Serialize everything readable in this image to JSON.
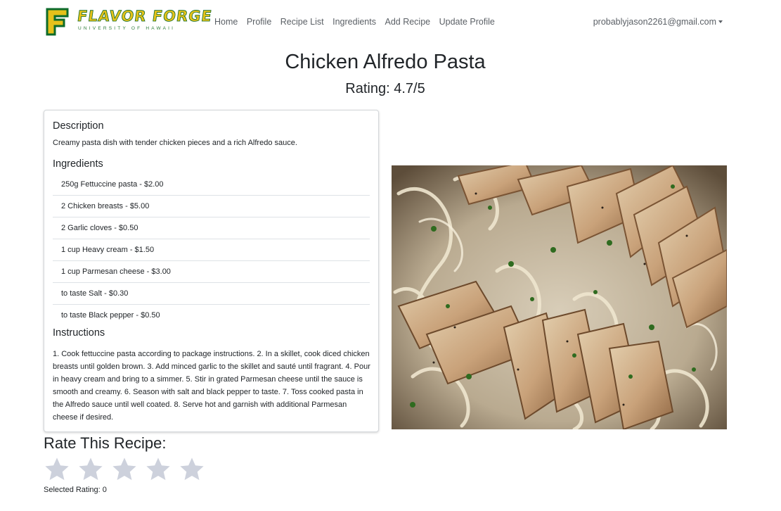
{
  "brand": {
    "name": "FLAVOR FORGE",
    "subtitle": "UNIVERSITY OF HAWAII"
  },
  "nav": {
    "links": [
      "Home",
      "Profile",
      "Recipe List",
      "Ingredients",
      "Add Recipe",
      "Update Profile"
    ],
    "user_email": "probablyjason2261@gmail.com"
  },
  "recipe": {
    "title": "Chicken Alfredo Pasta",
    "rating_text": "Rating: 4.7/5",
    "description_heading": "Description",
    "description": "Creamy pasta dish with tender chicken pieces and a rich Alfredo sauce.",
    "ingredients_heading": "Ingredients",
    "ingredients": [
      "250g Fettuccine pasta - $2.00",
      "2 Chicken breasts - $5.00",
      "2 Garlic cloves - $0.50",
      "1 cup Heavy cream - $1.50",
      "1 cup Parmesan cheese - $3.00",
      "to taste Salt - $0.30",
      "to taste Black pepper - $0.50"
    ],
    "instructions_heading": "Instructions",
    "instructions": "1. Cook fettuccine pasta according to package instructions. 2. In a skillet, cook diced chicken breasts until golden brown. 3. Add minced garlic to the skillet and sauté until fragrant. 4. Pour in heavy cream and bring to a simmer. 5. Stir in grated Parmesan cheese until the sauce is smooth and creamy. 6. Season with salt and black pepper to taste. 7. Toss cooked pasta in the Alfredo sauce until well coated. 8. Serve hot and garnish with additional Parmesan cheese if desired."
  },
  "rate": {
    "heading": "Rate This Recipe:",
    "star_count": 5,
    "selected_text": "Selected Rating: 0",
    "selected_value": 0
  },
  "colors": {
    "brand_yellow": "#e5c11a",
    "brand_green": "#0d6b2a",
    "star_empty": "#cdd1dc",
    "nav_text": "#5b6066"
  },
  "icons": {
    "star": "star-icon",
    "caret": "caret-down-icon"
  }
}
